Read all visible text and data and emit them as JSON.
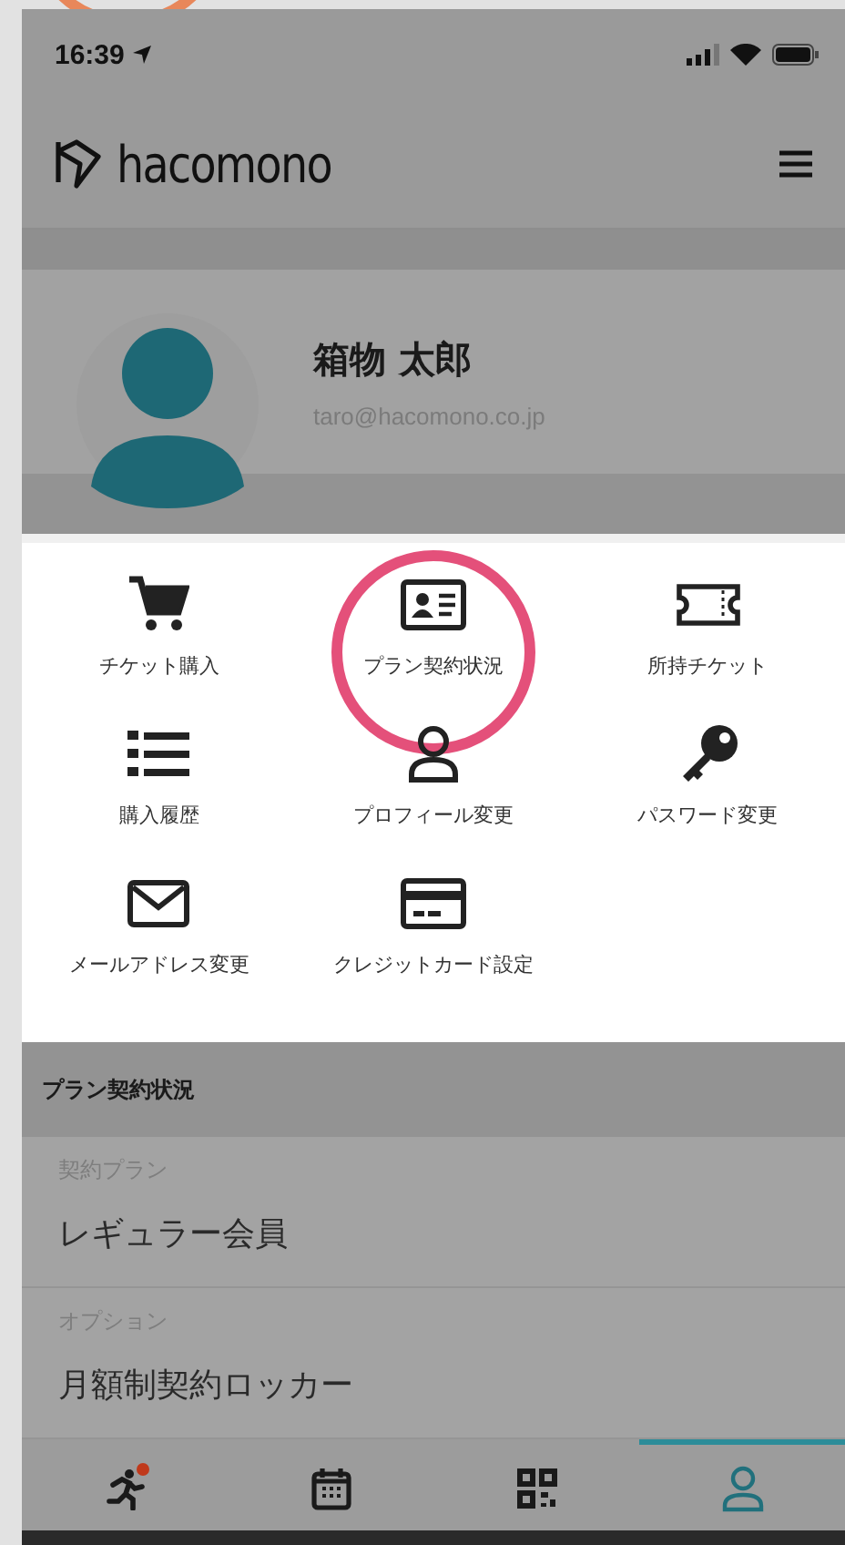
{
  "status_bar": {
    "time": "16:39"
  },
  "app_header": {
    "logo_text": "hacomono"
  },
  "profile": {
    "name": "箱物 太郎",
    "email": "taro@hacomono.co.jp"
  },
  "menu_items": [
    {
      "label": "チケット購入",
      "kind": "cart",
      "highlighted": false
    },
    {
      "label": "プラン契約状況",
      "kind": "card",
      "highlighted": true
    },
    {
      "label": "所持チケット",
      "kind": "ticket",
      "highlighted": false
    },
    {
      "label": "購入履歴",
      "kind": "list",
      "highlighted": false
    },
    {
      "label": "プロフィール変更",
      "kind": "person",
      "highlighted": false
    },
    {
      "label": "パスワード変更",
      "kind": "key",
      "highlighted": false
    },
    {
      "label": "メールアドレス変更",
      "kind": "envelope",
      "highlighted": false
    },
    {
      "label": "クレジットカード設定",
      "kind": "payment",
      "highlighted": false
    }
  ],
  "plan_section": {
    "title": "プラン契約状況",
    "fields": [
      {
        "label": "契約プラン",
        "value": "レギュラー会員"
      },
      {
        "label": "オプション",
        "value": "月額制契約ロッカー"
      }
    ]
  },
  "tab_bar": [
    {
      "kind": "runner",
      "selected": false,
      "badge": true
    },
    {
      "kind": "calendar",
      "selected": false,
      "badge": false
    },
    {
      "kind": "qr",
      "selected": false,
      "badge": false
    },
    {
      "kind": "person",
      "selected": true,
      "badge": false
    }
  ]
}
